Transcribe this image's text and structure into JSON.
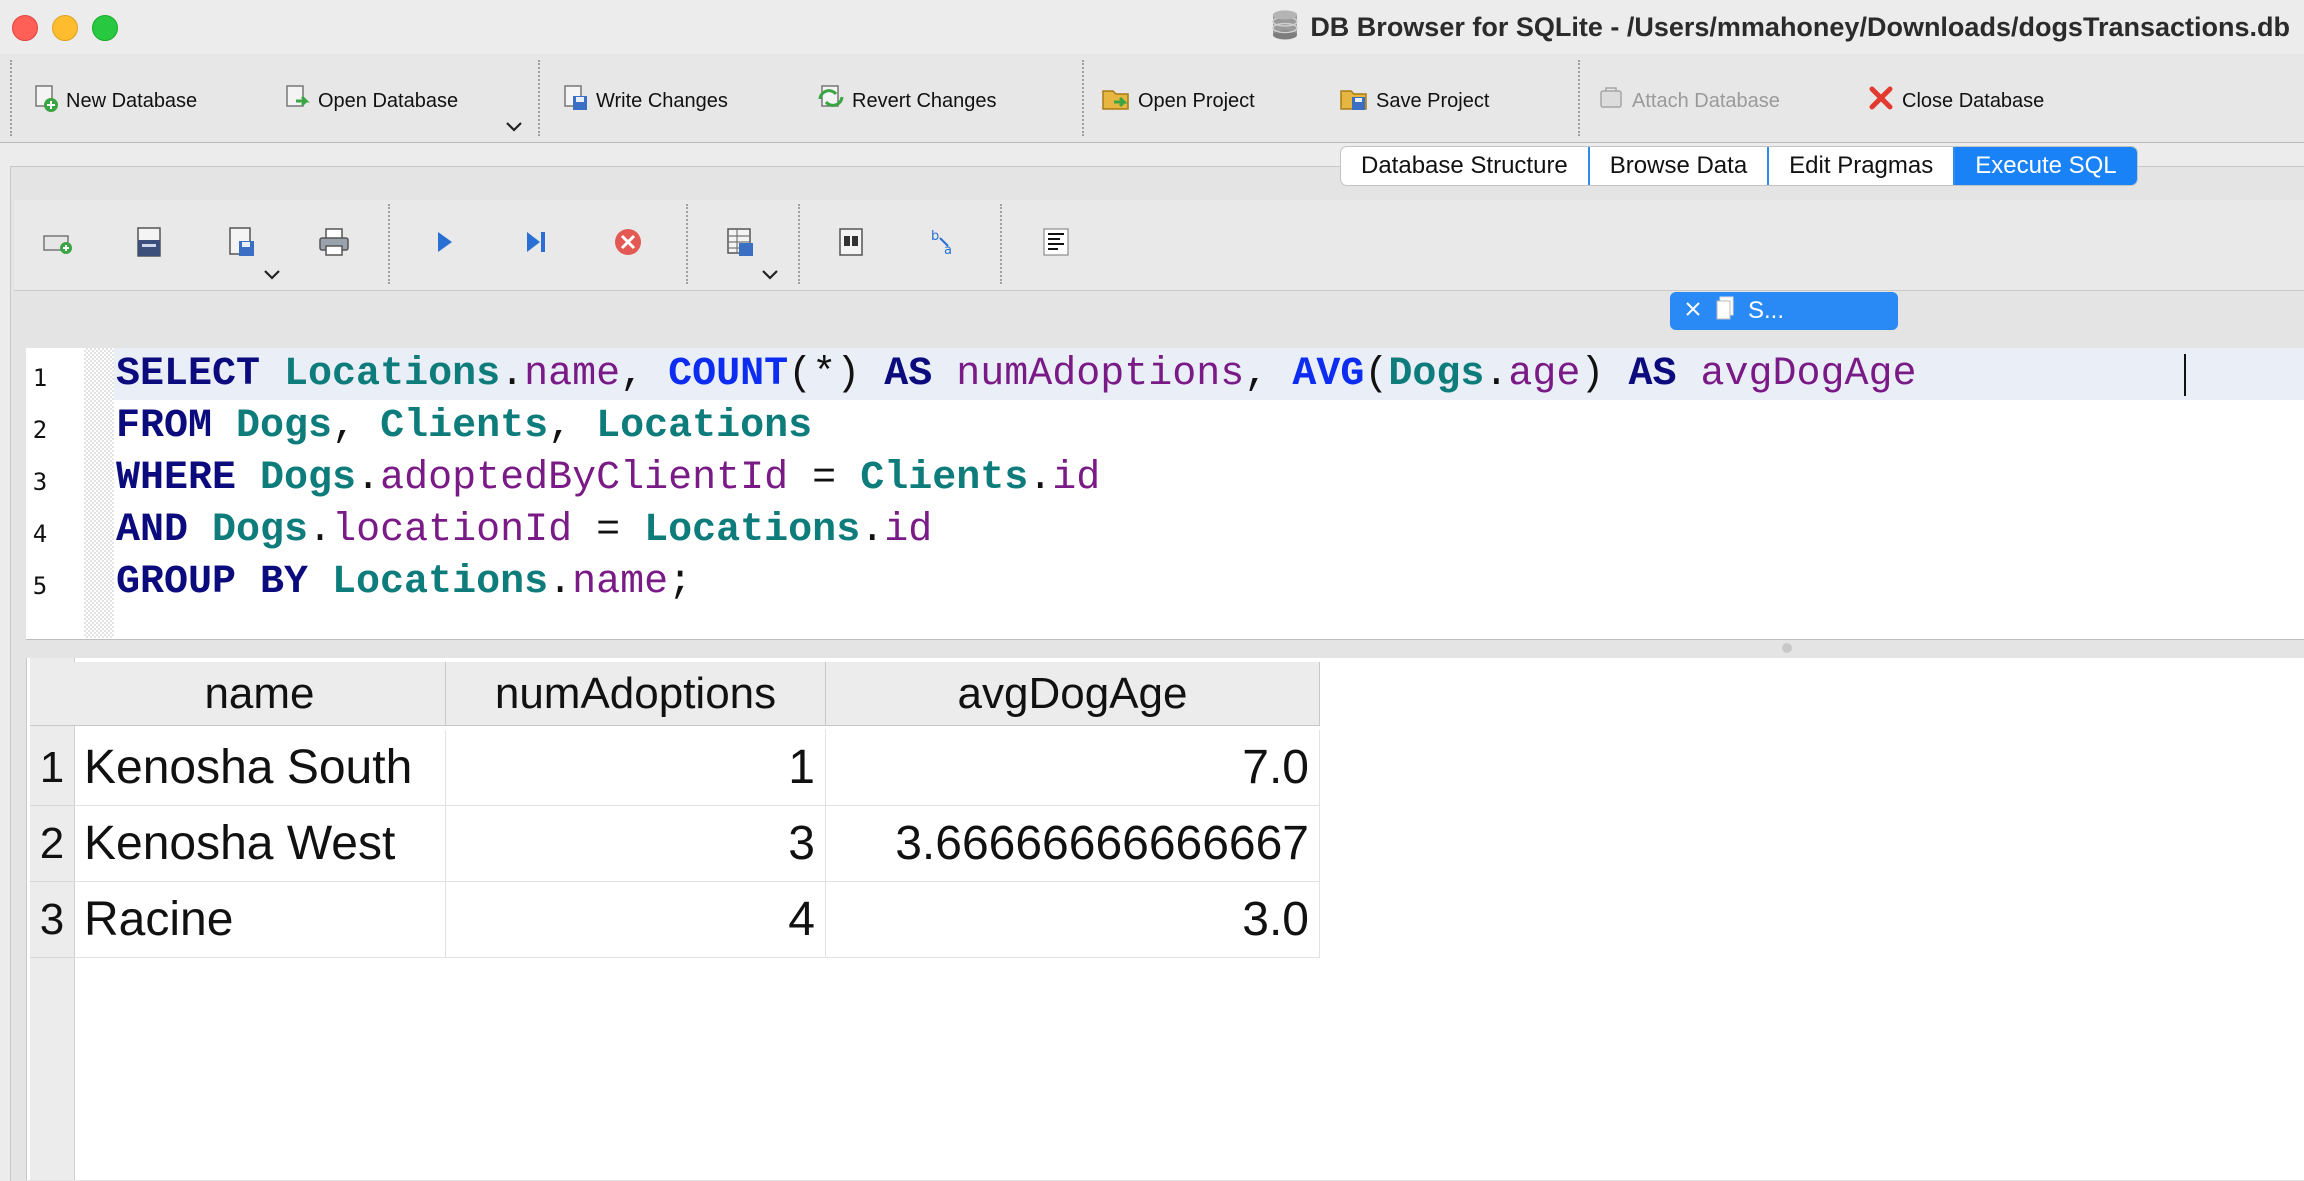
{
  "window": {
    "title": "DB Browser for SQLite - /Users/mmahoney/Downloads/dogsTransactions.db"
  },
  "colors": {
    "close": "#fe5f57",
    "minimize": "#febc2e",
    "zoom": "#28c840",
    "accent": "#1a82f7"
  },
  "main_toolbar": {
    "new_database": "New Database",
    "open_database": "Open Database",
    "write_changes": "Write Changes",
    "revert_changes": "Revert Changes",
    "open_project": "Open Project",
    "save_project": "Save Project",
    "attach_database": "Attach Database",
    "close_database": "Close Database"
  },
  "tabs": [
    {
      "label": "Database Structure",
      "active": false
    },
    {
      "label": "Browse Data",
      "active": false
    },
    {
      "label": "Edit Pragmas",
      "active": false
    },
    {
      "label": "Execute SQL",
      "active": true
    }
  ],
  "editor_tab": {
    "label": "S..."
  },
  "editor": {
    "line_numbers": [
      "1",
      "2",
      "3",
      "4",
      "5"
    ],
    "tokens": {
      "select": "SELECT",
      "locations": "Locations",
      "dot": ".",
      "name": "name",
      "comma": ",",
      "count": "COUNT",
      "paren_star": "(*)",
      "as": "AS",
      "num_adoptions": "numAdoptions",
      "avg": "AVG",
      "lparen": "(",
      "dogs": "Dogs",
      "age": "age",
      "rparen": ")",
      "avg_dog_age": "avgDogAge",
      "from": "FROM",
      "clients": "Clients",
      "where": "WHERE",
      "adopted_by_client_id": "adoptedByClientId",
      "eq": "=",
      "id": "id",
      "and": "AND",
      "location_id": "locationId",
      "group_by": "GROUP BY",
      "semicolon": ";"
    }
  },
  "results": {
    "columns": [
      "name",
      "numAdoptions",
      "avgDogAge"
    ],
    "rows": [
      {
        "num": "1",
        "name": "Kenosha South",
        "numAdoptions": "1",
        "avgDogAge": "7.0"
      },
      {
        "num": "2",
        "name": "Kenosha West",
        "numAdoptions": "3",
        "avgDogAge": "3.66666666666667"
      },
      {
        "num": "3",
        "name": "Racine",
        "numAdoptions": "4",
        "avgDogAge": "3.0"
      }
    ]
  }
}
